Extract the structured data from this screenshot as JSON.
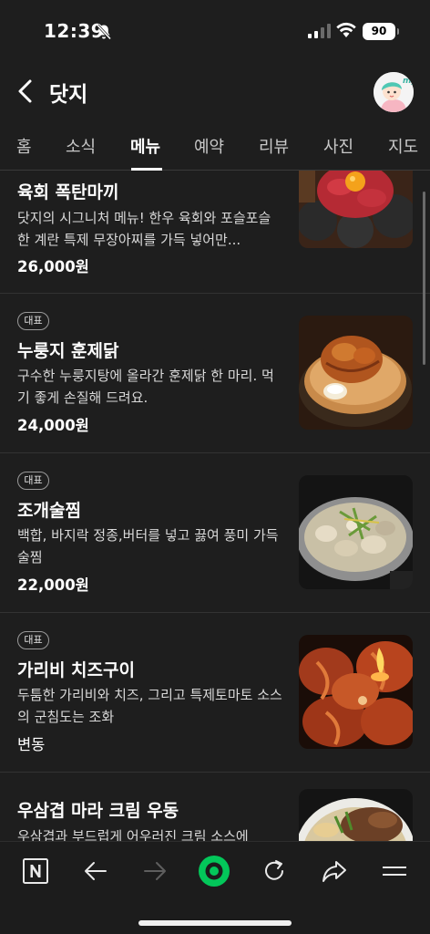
{
  "status_bar": {
    "time": "12:39",
    "battery": "90"
  },
  "header": {
    "title": "닷지",
    "avatar_badge": "my"
  },
  "tabs": [
    {
      "label": "홈"
    },
    {
      "label": "소식"
    },
    {
      "label": "메뉴"
    },
    {
      "label": "예약"
    },
    {
      "label": "리뷰"
    },
    {
      "label": "사진"
    },
    {
      "label": "지도"
    }
  ],
  "active_tab": "메뉴",
  "menu": {
    "items": [
      {
        "badge": "",
        "name": "육회 폭탄마끼",
        "description": "닷지의 시그니처 메뉴! 한우 육회와 포슬포슬한 계란 특제 무장아찌를 가득 넣어만...",
        "price": "26,000원"
      },
      {
        "badge": "대표",
        "name": "누룽지 훈제닭",
        "description": "구수한 누룽지탕에 올라간 훈제닭 한 마리. 먹기 좋게 손질해 드려요.",
        "price": "24,000원"
      },
      {
        "badge": "대표",
        "name": "조개술찜",
        "description": "백합, 바지락 정종,버터를 넣고 끓여 풍미 가득 술찜",
        "price": "22,000원"
      },
      {
        "badge": "대표",
        "name": "가리비 치즈구이",
        "description": "두툼한 가리비와 치즈, 그리고 특제토마토 소스의 군침도는 조화",
        "price": "변동"
      },
      {
        "badge": "",
        "name": "우삼겹 마라 크림 우동",
        "description": "우삼겹과 부드럽게 어우러진 크림 소스에",
        "price": ""
      }
    ]
  },
  "bottom_nav": {
    "icons": [
      "naver-n-icon",
      "back-arrow-icon",
      "forward-arrow-icon",
      "green-dot-icon",
      "refresh-icon",
      "share-icon",
      "menu-icon"
    ]
  },
  "colors": {
    "background": "#1e1e1e",
    "accent_green": "#03c75a"
  }
}
